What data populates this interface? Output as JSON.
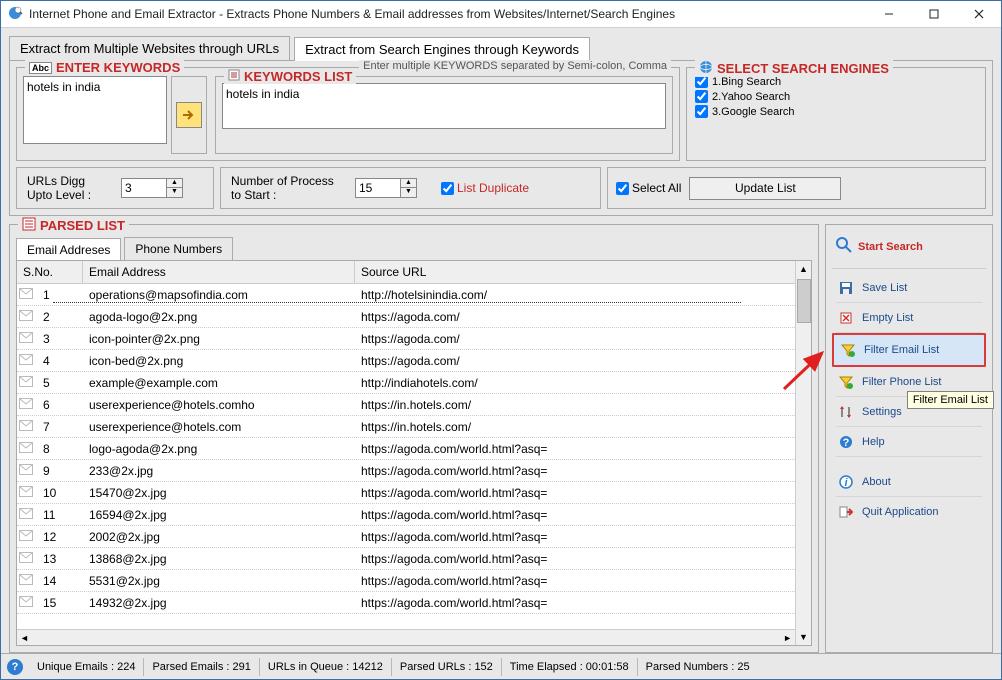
{
  "title": "Internet Phone and Email Extractor - Extracts Phone Numbers & Email addresses from Websites/Internet/Search Engines",
  "main_tabs": {
    "urls": "Extract from Multiple Websites through URLs",
    "keywords": "Extract from Search Engines through Keywords"
  },
  "keywords_panel": {
    "title": "ENTER KEYWORDS",
    "hint": "Enter multiple KEYWORDS separated by Semi-colon, Comma",
    "input_value": "hotels in india",
    "list_title": "KEYWORDS LIST",
    "list_value": "hotels in india"
  },
  "search_engines": {
    "title": "SELECT SEARCH ENGINES",
    "items": [
      "1.Bing Search",
      "2.Yahoo Search",
      "3.Google Search"
    ],
    "select_all": "Select All",
    "update": "Update List"
  },
  "options": {
    "digg_label": "URLs Digg Upto Level :",
    "digg_value": "3",
    "proc_label": "Number of Process to Start :",
    "proc_value": "15",
    "list_dup": "List Duplicate"
  },
  "parsed": {
    "title": "PARSED LIST",
    "tab_email": "Email Addreses",
    "tab_phone": "Phone Numbers",
    "cols": {
      "sno": "S.No.",
      "email": "Email Address",
      "src": "Source URL"
    },
    "rows": [
      {
        "n": "1",
        "e": "operations@mapsofindia.com",
        "s": "http://hotelsinindia.com/"
      },
      {
        "n": "2",
        "e": "agoda-logo@2x.png",
        "s": "https://agoda.com/"
      },
      {
        "n": "3",
        "e": "icon-pointer@2x.png",
        "s": "https://agoda.com/"
      },
      {
        "n": "4",
        "e": "icon-bed@2x.png",
        "s": "https://agoda.com/"
      },
      {
        "n": "5",
        "e": "example@example.com",
        "s": "http://indiahotels.com/"
      },
      {
        "n": "6",
        "e": "userexperience@hotels.comho",
        "s": "https://in.hotels.com/"
      },
      {
        "n": "7",
        "e": "userexperience@hotels.com",
        "s": "https://in.hotels.com/"
      },
      {
        "n": "8",
        "e": "logo-agoda@2x.png",
        "s": "https://agoda.com/world.html?asq="
      },
      {
        "n": "9",
        "e": "233@2x.jpg",
        "s": "https://agoda.com/world.html?asq="
      },
      {
        "n": "10",
        "e": "15470@2x.jpg",
        "s": "https://agoda.com/world.html?asq="
      },
      {
        "n": "11",
        "e": "16594@2x.jpg",
        "s": "https://agoda.com/world.html?asq="
      },
      {
        "n": "12",
        "e": "2002@2x.jpg",
        "s": "https://agoda.com/world.html?asq="
      },
      {
        "n": "13",
        "e": "13868@2x.jpg",
        "s": "https://agoda.com/world.html?asq="
      },
      {
        "n": "14",
        "e": "5531@2x.jpg",
        "s": "https://agoda.com/world.html?asq="
      },
      {
        "n": "15",
        "e": "14932@2x.jpg",
        "s": "https://agoda.com/world.html?asq="
      }
    ]
  },
  "side": {
    "start": "Start Search",
    "save": "Save List",
    "empty": "Empty List",
    "filter_email": "Filter Email List",
    "filter_phone": "Filter Phone List",
    "settings": "Settings",
    "help": "Help",
    "about": "About",
    "quit": "Quit Application",
    "tooltip": "Filter Email List"
  },
  "status": {
    "unique": "Unique Emails :  224",
    "parsed_emails": "Parsed Emails :  291",
    "queue": "URLs in Queue :  14212",
    "parsed_urls": "Parsed URLs :  152",
    "elapsed": "Time Elapsed :   00:01:58",
    "parsed_numbers": "Parsed Numbers :  25"
  }
}
